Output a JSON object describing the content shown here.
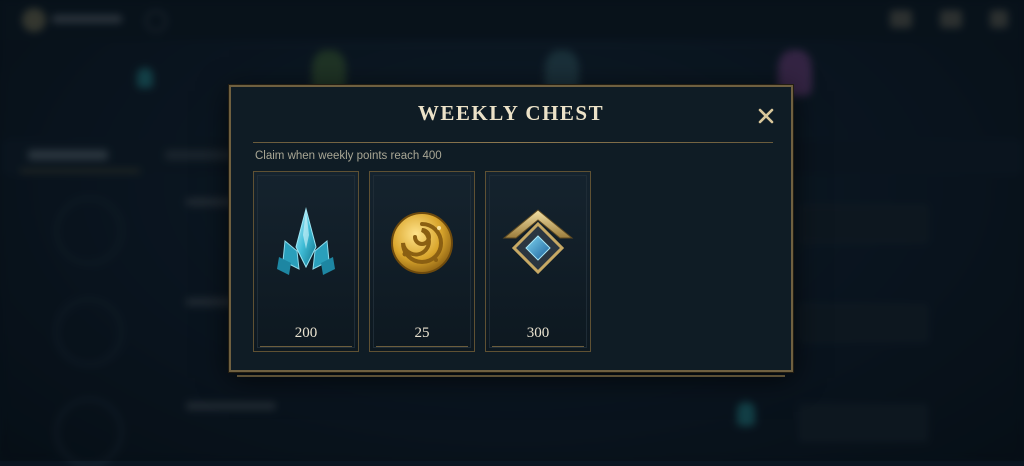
{
  "modal": {
    "title": "WEEKLY CHEST",
    "subtitle": "Claim when weekly points reach 400",
    "close_icon": "close-icon"
  },
  "rewards": [
    {
      "icon": "blue-essence-crystal-icon",
      "value": "200"
    },
    {
      "icon": "gold-coin-icon",
      "value": "25"
    },
    {
      "icon": "rank-emblem-icon",
      "value": "300"
    }
  ],
  "colors": {
    "accent_gold": "#c8aa6e",
    "title_text": "#ece2c8",
    "panel_bg": "#0f1c25",
    "border_gold": "#6f6040"
  }
}
